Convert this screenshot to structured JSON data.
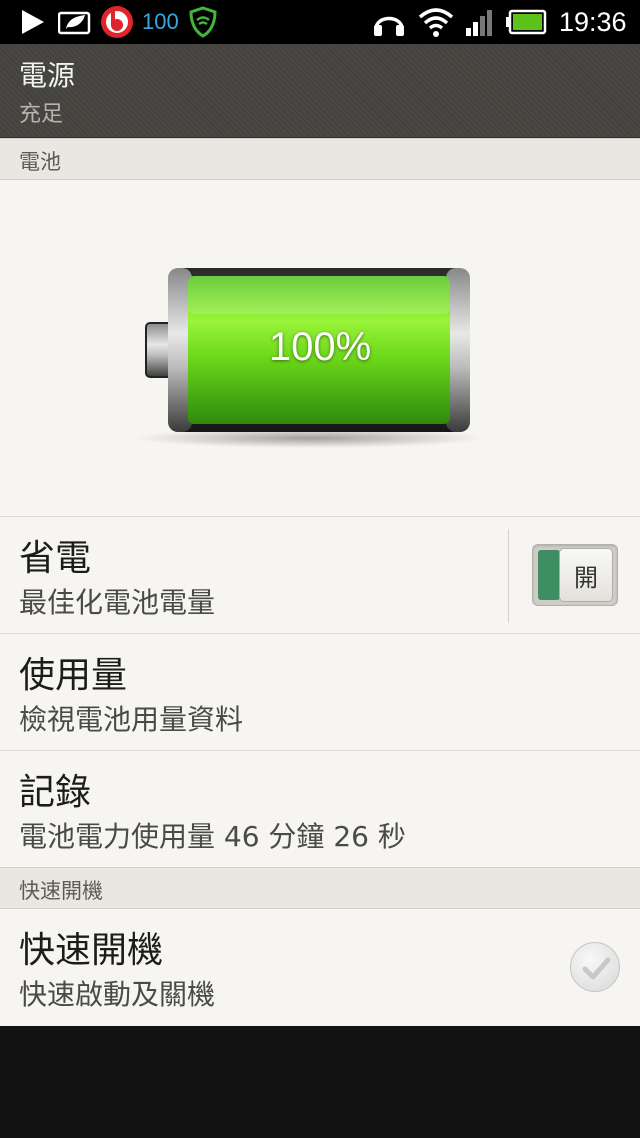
{
  "status_bar": {
    "badge_count": "100",
    "time": "19:36",
    "icons": [
      "play-icon",
      "leaf-icon",
      "beats-icon",
      "shield-icon",
      "headphones-icon",
      "wifi-icon",
      "signal-icon",
      "battery-icon"
    ]
  },
  "header": {
    "title": "電源",
    "subtitle": "充足"
  },
  "battery_section": {
    "header": "電池",
    "percent_label": "100%",
    "level": 1.0
  },
  "power_saver": {
    "title": "省電",
    "subtitle": "最佳化電池電量",
    "toggle_label": "開"
  },
  "usage": {
    "title": "使用量",
    "subtitle": "檢視電池用量資料"
  },
  "history": {
    "title": "記錄",
    "subtitle": "電池電力使用量 46 分鐘 26 秒"
  },
  "fast_boot_section": {
    "header": "快速開機",
    "title": "快速開機",
    "subtitle": "快速啟動及關機",
    "checked": false
  },
  "colors": {
    "accent_green": "#3f8d62",
    "battery_green": "#7ee81a",
    "header_bg": "#46443f"
  }
}
